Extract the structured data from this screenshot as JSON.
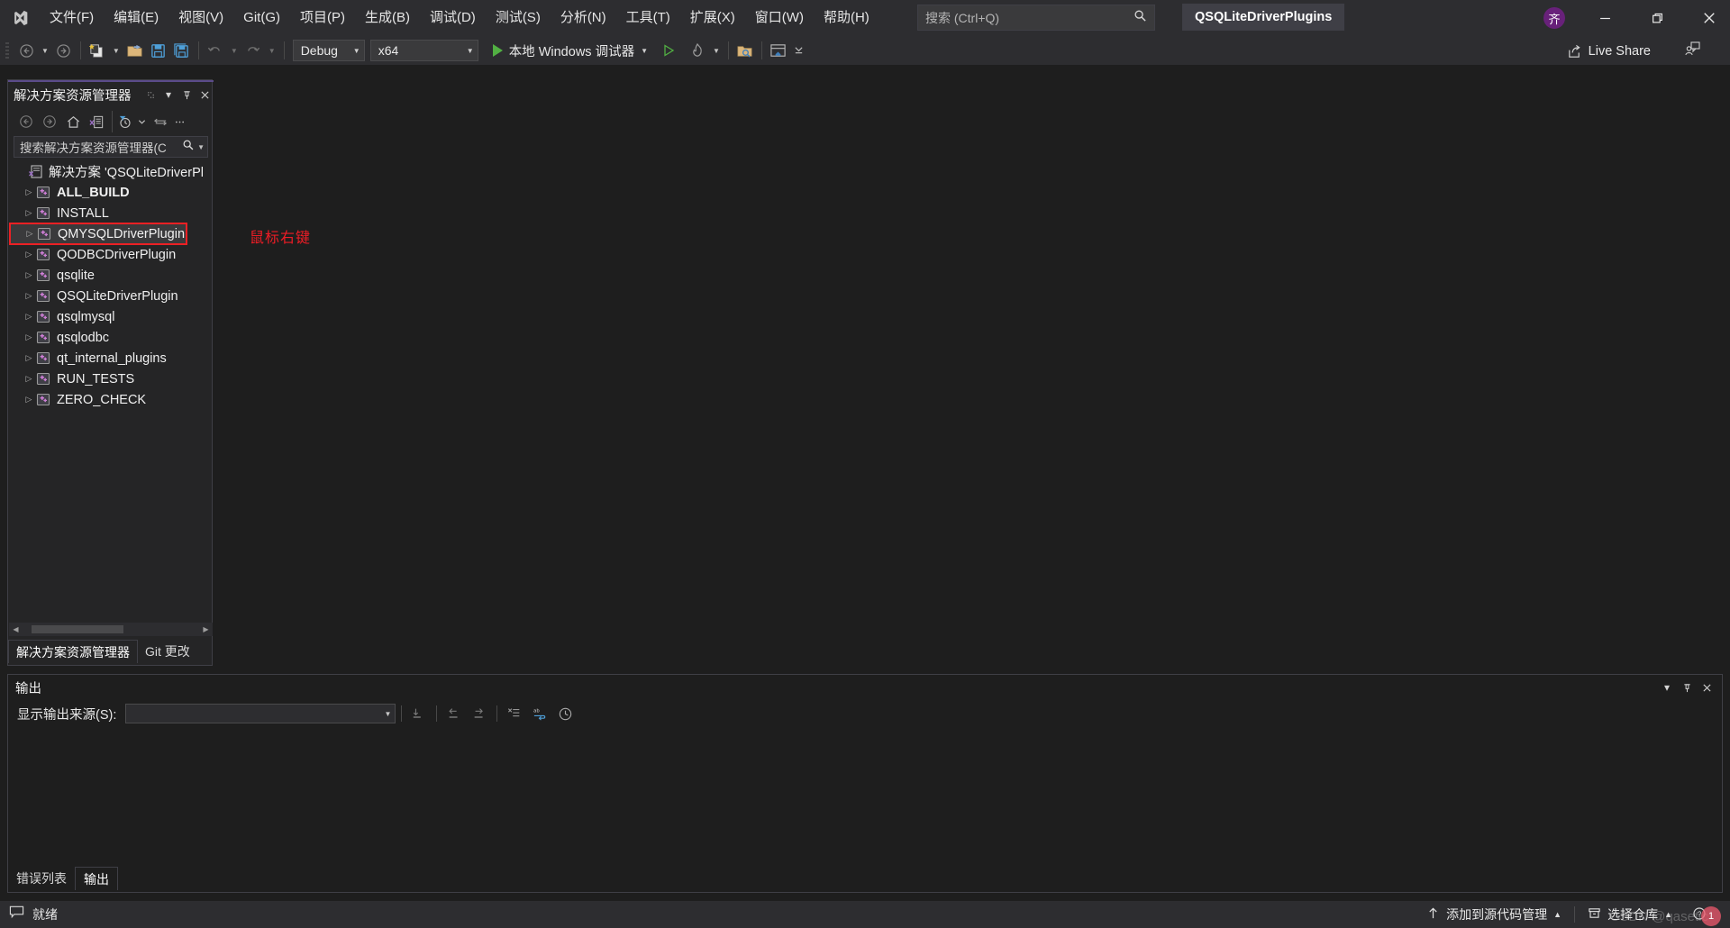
{
  "window": {
    "title": "QSQLiteDriverPlugins",
    "user_initial": "齐",
    "minimize_icon": "minimize-icon",
    "maximize_icon": "maximize-icon",
    "close_icon": "close-icon"
  },
  "menubar": {
    "logo_icon": "visual-studio-logo-icon",
    "items": [
      {
        "label": "文件(F)"
      },
      {
        "label": "编辑(E)"
      },
      {
        "label": "视图(V)"
      },
      {
        "label": "Git(G)"
      },
      {
        "label": "项目(P)"
      },
      {
        "label": "生成(B)"
      },
      {
        "label": "调试(D)"
      },
      {
        "label": "测试(S)"
      },
      {
        "label": "分析(N)"
      },
      {
        "label": "工具(T)"
      },
      {
        "label": "扩展(X)"
      },
      {
        "label": "窗口(W)"
      },
      {
        "label": "帮助(H)"
      }
    ]
  },
  "search": {
    "placeholder": "搜索 (Ctrl+Q)",
    "icon": "search-icon"
  },
  "toolbar": {
    "nav_back_icon": "navigate-back-icon",
    "nav_forward_icon": "navigate-forward-icon",
    "new_item_icon": "new-item-icon",
    "open_file_icon": "open-file-icon",
    "save_icon": "save-icon",
    "save_all_icon": "save-all-icon",
    "undo_icon": "undo-icon",
    "redo_icon": "redo-icon",
    "configuration": "Debug",
    "platform": "x64",
    "run_label": "本地 Windows 调试器",
    "run_icon": "play-icon",
    "start_no_debug_icon": "play-outline-icon",
    "hot_reload_icon": "hot-reload-icon",
    "folder_search_icon": "folder-search-icon",
    "window_layout_icon": "window-layout-icon",
    "overflow_icon": "toolbar-overflow-icon"
  },
  "live_share": {
    "label": "Live Share",
    "icon": "live-share-icon",
    "feedback_icon": "send-feedback-icon"
  },
  "solution_explorer": {
    "title": "解决方案资源管理器",
    "header_buttons": [
      {
        "icon": "drag-handle-icon"
      },
      {
        "icon": "chevron-down-icon"
      },
      {
        "icon": "pin-icon"
      },
      {
        "icon": "close-icon"
      }
    ],
    "toolbar_buttons": [
      {
        "icon": "back-icon"
      },
      {
        "icon": "forward-icon"
      },
      {
        "icon": "home-icon"
      },
      {
        "icon": "solution-view-icon"
      },
      {
        "icon": "pending-changes-filter-icon"
      },
      {
        "icon": "chevron-down-icon"
      },
      {
        "icon": "sync-with-active-document-icon"
      },
      {
        "icon": "overflow-icon"
      }
    ],
    "search_placeholder": "搜索解决方案资源管理器(C",
    "search_icon": "search-icon",
    "search_dropdown_icon": "chevron-down-icon",
    "solution_node": {
      "label": "解决方案 'QSQLiteDriverPl",
      "icon": "solution-icon"
    },
    "tree_items": [
      {
        "label": "ALL_BUILD",
        "icon": "cpp-project-icon",
        "bold": true,
        "highlighted": false
      },
      {
        "label": "INSTALL",
        "icon": "cpp-project-icon",
        "bold": false,
        "highlighted": false
      },
      {
        "label": "QMYSQLDriverPlugin",
        "icon": "cpp-project-icon",
        "bold": false,
        "highlighted": true
      },
      {
        "label": "QODBCDriverPlugin",
        "icon": "cpp-project-icon",
        "bold": false,
        "highlighted": false
      },
      {
        "label": "qsqlite",
        "icon": "cpp-project-icon",
        "bold": false,
        "highlighted": false
      },
      {
        "label": "QSQLiteDriverPlugin",
        "icon": "cpp-project-icon",
        "bold": false,
        "highlighted": false
      },
      {
        "label": "qsqlmysql",
        "icon": "cpp-project-icon",
        "bold": false,
        "highlighted": false
      },
      {
        "label": "qsqlodbc",
        "icon": "cpp-project-icon",
        "bold": false,
        "highlighted": false
      },
      {
        "label": "qt_internal_plugins",
        "icon": "cpp-project-icon",
        "bold": false,
        "highlighted": false
      },
      {
        "label": "RUN_TESTS",
        "icon": "cpp-project-icon",
        "bold": false,
        "highlighted": false
      },
      {
        "label": "ZERO_CHECK",
        "icon": "cpp-project-icon",
        "bold": false,
        "highlighted": false
      }
    ],
    "tabs": [
      {
        "label": "解决方案资源管理器",
        "active": true
      },
      {
        "label": "Git 更改",
        "active": false
      }
    ]
  },
  "annotation": {
    "text": "鼠标右键",
    "color": "#ee1c25"
  },
  "output_panel": {
    "title": "输出",
    "source_label": "显示输出来源(S):",
    "source_value": "",
    "header_buttons": [
      {
        "icon": "chevron-down-icon"
      },
      {
        "icon": "pin-icon"
      },
      {
        "icon": "close-icon"
      }
    ],
    "toolbar_buttons": [
      {
        "icon": "find-message-icon"
      },
      {
        "icon": "go-to-previous-icon"
      },
      {
        "icon": "go-to-next-icon"
      },
      {
        "icon": "clear-all-icon"
      },
      {
        "icon": "toggle-word-wrap-icon"
      },
      {
        "icon": "show-timestamps-icon"
      }
    ],
    "tabs": [
      {
        "label": "错误列表",
        "active": false
      },
      {
        "label": "输出",
        "active": true
      }
    ]
  },
  "statusbar": {
    "status_icon": "ready-icon",
    "status_text": "就绪",
    "source_control_icon": "add-to-source-control-icon",
    "source_control_label": "添加到源代码管理",
    "source_control_chevron": "chevron-up-icon",
    "repository_icon": "repository-icon",
    "repository_label": "选择仓库",
    "repository_chevron": "chevron-up-icon",
    "notification_icon": "notifications-icon",
    "watermark": "CSDN @qasetic",
    "cursor_badge": "1"
  },
  "colors": {
    "accent": "#5b4b8a",
    "window_bg": "#1e1e1e",
    "chrome_bg": "#2d2d30",
    "panel_bg": "#252526",
    "border": "#3f3f46",
    "text": "#f0f0f0",
    "annotation_red": "#ee1c25",
    "run_green": "#52b043"
  }
}
